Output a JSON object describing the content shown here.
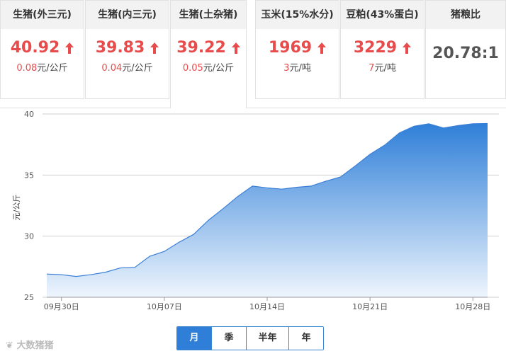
{
  "cards": [
    {
      "title": "生猪(外三元)",
      "value": "40.92",
      "change": "0.08",
      "unit": "元/公斤",
      "up": true
    },
    {
      "title": "生猪(内三元)",
      "value": "39.83",
      "change": "0.04",
      "unit": "元/公斤",
      "up": true
    },
    {
      "title": "生猪(土杂猪)",
      "value": "39.22",
      "change": "0.05",
      "unit": "元/公斤",
      "up": true
    },
    {
      "title": "玉米(15%水分)",
      "value": "1969",
      "change": "3",
      "unit": "元/吨",
      "up": true
    },
    {
      "title": "豆粕(43%蛋白)",
      "value": "3229",
      "change": "7",
      "unit": "元/吨",
      "up": true
    },
    {
      "title": "猪粮比",
      "value": "20.78:1"
    }
  ],
  "tabs": [
    "月",
    "季",
    "半年",
    "年"
  ],
  "selected_tab": "月",
  "watermark": "大数猪猪",
  "colors": {
    "up": "#e84b4b",
    "line": "#3a7fd5",
    "accent": "#2f7fd8"
  },
  "chart_data": {
    "type": "area",
    "title": "",
    "ylabel": "元/公斤",
    "xlabel": "",
    "ylim": [
      25,
      40
    ],
    "yticks": [
      25,
      30,
      35,
      40
    ],
    "x_dates": [
      "09月29日",
      "09月30日",
      "10月01日",
      "10月02日",
      "10月03日",
      "10月04日",
      "10月05日",
      "10月06日",
      "10月07日",
      "10月08日",
      "10月09日",
      "10月10日",
      "10月11日",
      "10月12日",
      "10月13日",
      "10月14日",
      "10月15日",
      "10月16日",
      "10月17日",
      "10月18日",
      "10月19日",
      "10月20日",
      "10月21日",
      "10月22日",
      "10月23日",
      "10月24日",
      "10月25日",
      "10月26日",
      "10月27日",
      "10月28日",
      "10月29日"
    ],
    "values": [
      26.9,
      26.85,
      26.7,
      26.85,
      27.05,
      27.4,
      27.45,
      28.35,
      28.75,
      29.5,
      30.15,
      31.3,
      32.25,
      33.25,
      34.1,
      33.95,
      33.85,
      34.0,
      34.1,
      34.5,
      34.85,
      35.75,
      36.7,
      37.45,
      38.45,
      39.0,
      39.2,
      38.85,
      39.05,
      39.2,
      39.22
    ],
    "xtick_labels": [
      "09月30日",
      "10月07日",
      "10月14日",
      "10月21日",
      "10月28日"
    ],
    "xtick_index": [
      1,
      8,
      15,
      22,
      29
    ],
    "grid": true,
    "legend": "none"
  }
}
